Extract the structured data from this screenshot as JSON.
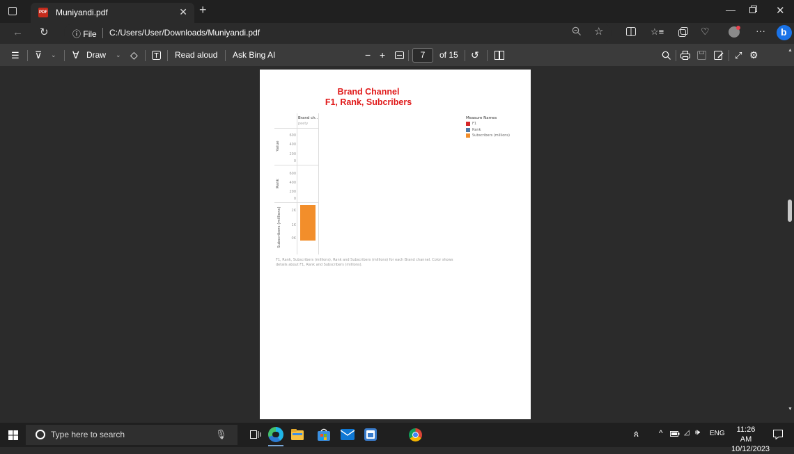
{
  "browser": {
    "tab_title": "Muniyandi.pdf",
    "pdf_badge": "PDF",
    "url_prefix": "File",
    "url": "C:/Users/User/Downloads/Muniyandi.pdf"
  },
  "pdf_toolbar": {
    "draw_label": "Draw",
    "read_aloud_label": "Read aloud",
    "ask_bing_label": "Ask Bing AI",
    "page_current": "7",
    "page_total": "of 15"
  },
  "chart_data": {
    "type": "bar",
    "title": "Brand Channel",
    "subtitle": "F1, Rank, Subcribers",
    "column_header": "Brand ch..",
    "category_label": "peety",
    "legend_title": "Measure Names",
    "series": [
      {
        "name": "F1",
        "color": "#d62728",
        "pane": "Value",
        "values": [
          0
        ]
      },
      {
        "name": "Rank",
        "color": "#4e79a7",
        "pane": "Rank",
        "values": [
          0
        ]
      },
      {
        "name": "Subscribers (millions)",
        "color": "#f28e2b",
        "pane": "Subscribers (millions)",
        "values": [
          2000
        ]
      }
    ],
    "panes": [
      {
        "label": "Value",
        "ticks": [
          "600",
          "400",
          "200",
          "0"
        ],
        "ylim": [
          0,
          700
        ]
      },
      {
        "label": "Rank",
        "ticks": [
          "600",
          "400",
          "200",
          "0"
        ],
        "ylim": [
          0,
          700
        ]
      },
      {
        "label": "Subscribers (millions)",
        "ticks": [
          "2K",
          "1K",
          "0K"
        ],
        "ylim": [
          0,
          2200
        ]
      }
    ],
    "caption": "F1, Rank, Subscribers (millions), Rank and Subscribers (millions) for each Brand channel.  Color shows details about F1, Rank and Subscribers (millions)."
  },
  "taskbar": {
    "search_placeholder": "Type here to search",
    "language": "ENG",
    "time": "11:26 AM",
    "date": "10/12/2023"
  }
}
